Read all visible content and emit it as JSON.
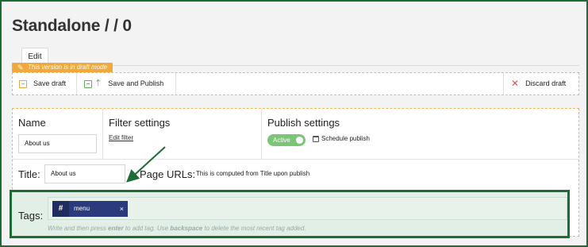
{
  "page": {
    "title": "Standalone / / 0"
  },
  "tabs": [
    {
      "label": "Edit"
    }
  ],
  "draft_badge": {
    "text": "This version is in draft mode"
  },
  "toolbar": {
    "save_draft": "Save draft",
    "save_publish": "Save and Publish",
    "discard_draft": "Discard draft"
  },
  "name_section": {
    "label": "Name",
    "value": "About us"
  },
  "filter_section": {
    "label": "Filter settings",
    "link": "Edit filter"
  },
  "publish_section": {
    "label": "Publish settings",
    "status": "Active",
    "schedule": "Schedule publish"
  },
  "title_field": {
    "label": "Title:",
    "value": "About us"
  },
  "page_urls": {
    "label": "Page URLs:",
    "text": "This is computed from Title upon publish"
  },
  "tags": {
    "label": "Tags:",
    "items": [
      {
        "icon": "#",
        "name": "menu",
        "remove": "×"
      }
    ],
    "help_prefix": "Write and then press ",
    "help_key1": "enter",
    "help_middle": " to add tag. Use ",
    "help_key2": "backspace",
    "help_suffix": " to delete the most recent tag added."
  },
  "colors": {
    "highlight_border": "#1e6b35",
    "draft_orange": "#f2a93b",
    "active_green": "#7cc576",
    "tag_navy": "#2a3a7c"
  }
}
